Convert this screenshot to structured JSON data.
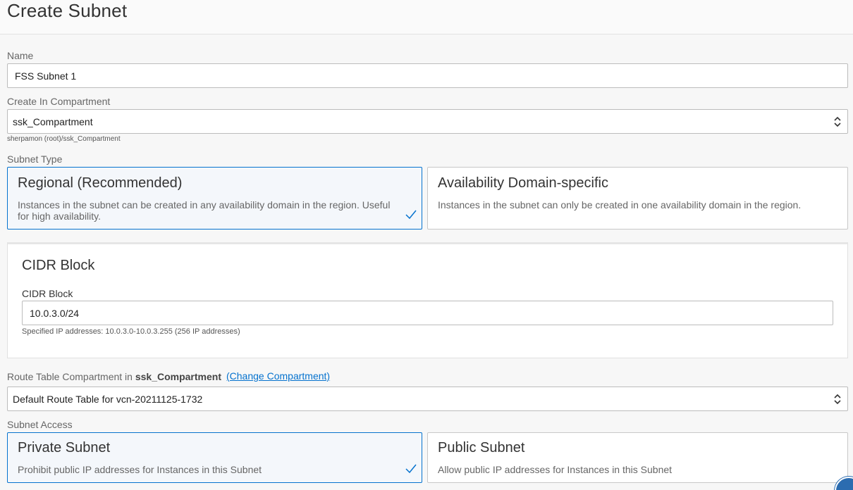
{
  "page": {
    "title": "Create Subnet"
  },
  "name_field": {
    "label": "Name",
    "value": "FSS Subnet 1"
  },
  "compartment": {
    "label": "Create In Compartment",
    "value": "ssk_Compartment",
    "path": "sherpamon (root)/ssk_Compartment"
  },
  "subnet_type": {
    "label": "Subnet Type",
    "options": [
      {
        "title": "Regional (Recommended)",
        "desc": "Instances in the subnet can be created in any availability domain in the region. Useful for high availability.",
        "selected": true
      },
      {
        "title": "Availability Domain-specific",
        "desc": "Instances in the subnet can only be created in one availability domain in the region.",
        "selected": false
      }
    ]
  },
  "cidr": {
    "section_title": "CIDR Block",
    "label": "CIDR Block",
    "value": "10.0.3.0/24",
    "hint": "Specified IP addresses: 10.0.3.0-10.0.3.255 (256 IP addresses)"
  },
  "route_table": {
    "label_prefix": "Route Table Compartment in",
    "compartment": "ssk_Compartment",
    "change_link": "(Change Compartment)",
    "value": "Default Route Table for vcn-20211125-1732"
  },
  "subnet_access": {
    "label": "Subnet Access",
    "options": [
      {
        "title": "Private Subnet",
        "desc": "Prohibit public IP addresses for Instances in this Subnet",
        "selected": true
      },
      {
        "title": "Public Subnet",
        "desc": "Allow public IP addresses for Instances in this Subnet",
        "selected": false
      }
    ]
  },
  "colors": {
    "accent": "#0572ce",
    "selected_bg": "#f4f7fb",
    "border": "#bcbcbc"
  },
  "icons": {
    "check": "check-icon",
    "chevrons": "chevron-up-down-icon",
    "help": "help-chat-icon"
  }
}
